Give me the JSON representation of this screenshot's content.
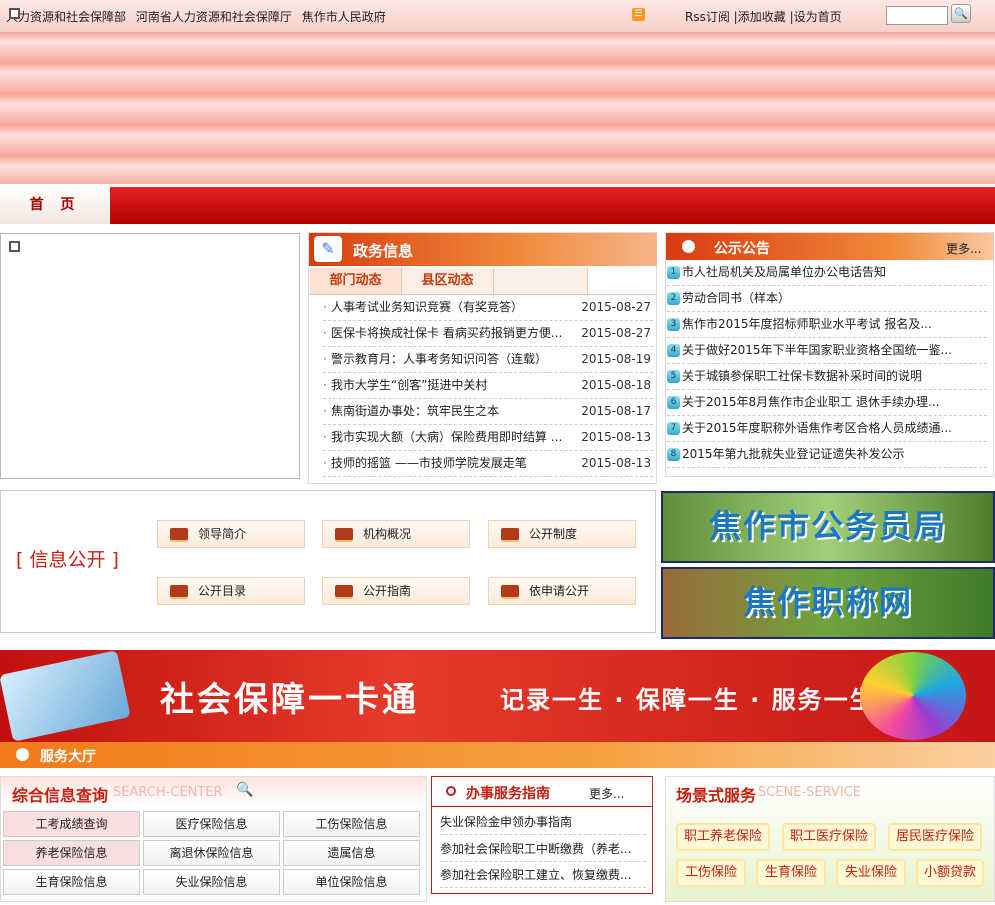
{
  "header": {
    "links": [
      "人力资源和社会保障部",
      "河南省人力资源和社会保障厅",
      "焦作市人民政府"
    ],
    "right_links": [
      "Rss订阅",
      "添加收藏",
      "设为首页"
    ],
    "rss_glyph": "☰",
    "search_glyph": "🔍"
  },
  "nav": {
    "home_label": "首 页"
  },
  "zhengwu": {
    "title": "政务信息",
    "tabs": [
      "部门动态",
      "县区动态"
    ],
    "items": [
      {
        "title": "人事考试业务知识竞赛（有奖竞答）",
        "date": "2015-08-27"
      },
      {
        "title": "医保卡将换成社保卡 看病买药报销更方便...",
        "date": "2015-08-27"
      },
      {
        "title": "警示教育月：人事考务知识问答（连载）",
        "date": "2015-08-19"
      },
      {
        "title": "我市大学生“创客”挺进中关村",
        "date": "2015-08-18"
      },
      {
        "title": "焦南街道办事处：筑牢民生之本",
        "date": "2015-08-17"
      },
      {
        "title": "我市实现大额（大病）保险费用即时结算 ...",
        "date": "2015-08-13"
      },
      {
        "title": "技师的摇篮 ——市技师学院发展走笔",
        "date": "2015-08-13"
      }
    ]
  },
  "notices": {
    "title": "公示公告",
    "more": "更多...",
    "items": [
      {
        "num": "1",
        "text": "市人社局机关及局属单位办公电话告知"
      },
      {
        "num": "2",
        "text": "劳动合同书（样本）"
      },
      {
        "num": "3",
        "text": "焦作市2015年度招标师职业水平考试 报名及..."
      },
      {
        "num": "4",
        "text": "关于做好2015年下半年国家职业资格全国统一鉴..."
      },
      {
        "num": "5",
        "text": "关于城镇参保职工社保卡数据补采时间的说明"
      },
      {
        "num": "6",
        "text": "关于2015年8月焦作市企业职工 退休手续办理..."
      },
      {
        "num": "7",
        "text": "关于2015年度职称外语焦作考区合格人员成绩通..."
      },
      {
        "num": "8",
        "text": "2015年第九批就失业登记证遗失补发公示"
      }
    ]
  },
  "info_public": {
    "title": "[ 信息公开 ]",
    "buttons": [
      "领导简介",
      "机构概况",
      "公开制度",
      "公开目录",
      "公开指南",
      "依申请公开"
    ]
  },
  "side_banners": [
    "焦作市公务员局",
    "焦作职称网"
  ],
  "card_banner": {
    "title": "社会保障一卡通",
    "slogan": "记录一生 · 保障一生 · 服务一生"
  },
  "service_hall": {
    "title": "服务大厅"
  },
  "search_center": {
    "title": "综合信息查询",
    "subtitle": "SEARCH-CENTER",
    "cells": [
      "工考成绩查询",
      "医疗保险信息",
      "工伤保险信息",
      "养老保险信息",
      "离退休保险信息",
      "遗属信息",
      "生育保险信息",
      "失业保险信息",
      "单位保险信息"
    ]
  },
  "guide": {
    "title": "办事服务指南",
    "more": "更多...",
    "items": [
      "失业保险金申领办事指南",
      "参加社会保险职工中断缴费（养老...",
      "参加社会保险职工建立、恢复缴费..."
    ]
  },
  "scene": {
    "title": "场景式服务",
    "subtitle": "SCENE-SERVICE",
    "buttons": [
      "职工养老保险",
      "职工医疗保险",
      "居民医疗保险",
      "工伤保险",
      "生育保险",
      "失业保险",
      "小额贷款"
    ]
  }
}
